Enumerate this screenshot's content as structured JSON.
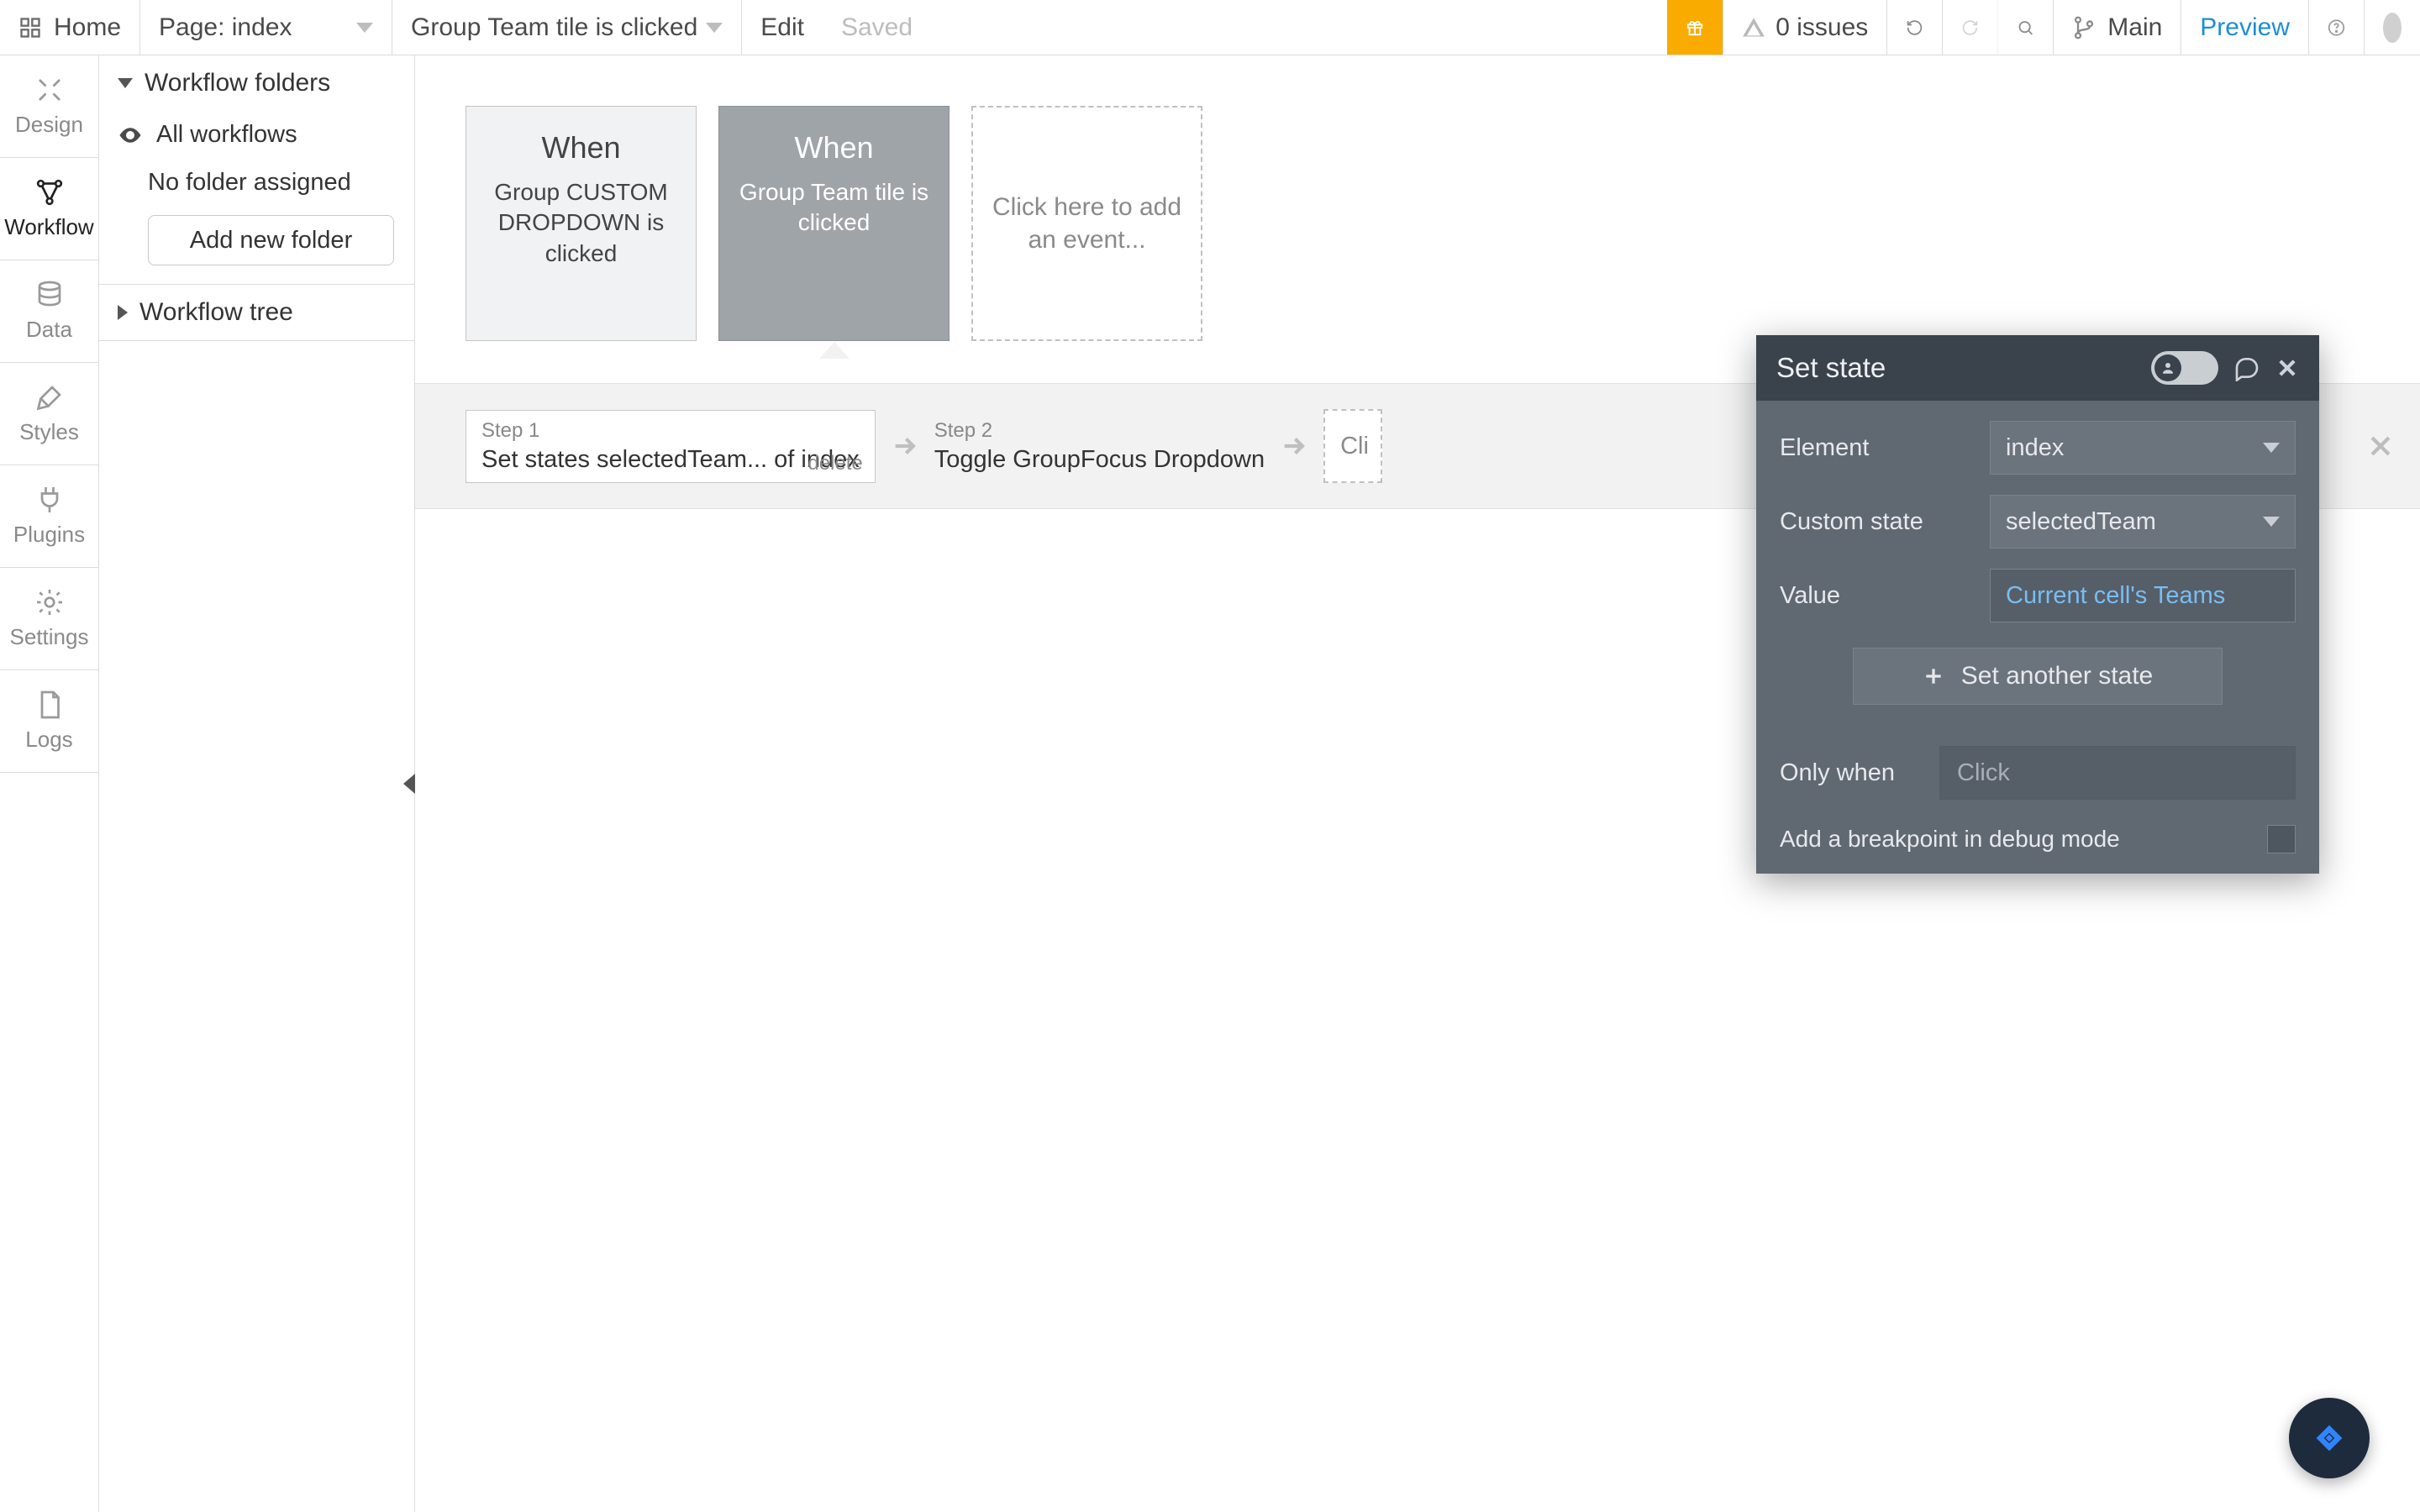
{
  "topbar": {
    "home": "Home",
    "page_label": "Page: index",
    "workflow_dropdown": "Group Team tile is clicked",
    "edit": "Edit",
    "saved": "Saved",
    "issues": "0 issues",
    "main": "Main",
    "preview": "Preview"
  },
  "rail": {
    "items": [
      "Design",
      "Workflow",
      "Data",
      "Styles",
      "Plugins",
      "Settings",
      "Logs"
    ],
    "active_index": 1
  },
  "sidepanel": {
    "folders_header": "Workflow folders",
    "all_workflows": "All workflows",
    "no_folder": "No folder assigned",
    "add_folder_btn": "Add new folder",
    "tree_header": "Workflow tree"
  },
  "events": [
    {
      "when": "When",
      "desc": "Group CUSTOM DROPDOWN is clicked",
      "selected": false
    },
    {
      "when": "When",
      "desc": "Group Team tile is clicked",
      "selected": true
    }
  ],
  "add_event_placeholder": "Click here to add an event...",
  "steps": [
    {
      "n": "Step 1",
      "t": "Set states selectedTeam... of index",
      "delete": "delete",
      "boxed": true
    },
    {
      "n": "Step 2",
      "t": "Toggle GroupFocus Dropdown",
      "boxed": false
    }
  ],
  "add_action_placeholder": "Cli",
  "prop": {
    "title": "Set state",
    "rows": {
      "element": {
        "label": "Element",
        "value": "index"
      },
      "custom_state": {
        "label": "Custom state",
        "value": "selectedTeam"
      },
      "value": {
        "label": "Value",
        "value": "Current cell's Teams"
      }
    },
    "add_another": "Set another state",
    "only_when": {
      "label": "Only when",
      "placeholder": "Click"
    },
    "breakpoint": "Add a breakpoint in debug mode"
  }
}
